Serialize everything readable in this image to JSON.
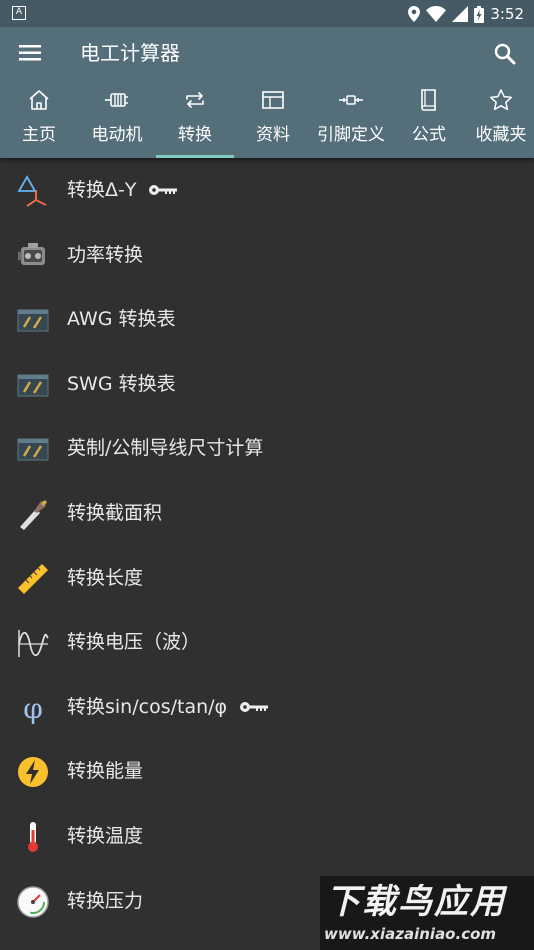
{
  "status_bar": {
    "notification_icon_letter": "A",
    "time": "3:52"
  },
  "app_bar": {
    "title": "电工计算器"
  },
  "tabs": [
    {
      "label": "主页",
      "icon": "home-icon"
    },
    {
      "label": "电动机",
      "icon": "motor-icon"
    },
    {
      "label": "转换",
      "icon": "convert-icon",
      "active": true
    },
    {
      "label": "资料",
      "icon": "table-icon"
    },
    {
      "label": "引脚定义",
      "icon": "connector-icon"
    },
    {
      "label": "公式",
      "icon": "book-icon"
    },
    {
      "label": "收藏夹",
      "icon": "star-icon"
    }
  ],
  "list": [
    {
      "label": "转换Δ-Y",
      "icon": "delta-star-icon",
      "locked": true
    },
    {
      "label": "功率转换",
      "icon": "engine-icon"
    },
    {
      "label": "AWG 转换表",
      "icon": "wire-table-icon"
    },
    {
      "label": "SWG 转换表",
      "icon": "wire-table-icon"
    },
    {
      "label": "英制/公制导线尺寸计算",
      "icon": "wire-table-icon"
    },
    {
      "label": "转换截面积",
      "icon": "cable-cross-section-icon"
    },
    {
      "label": "转换长度",
      "icon": "ruler-icon"
    },
    {
      "label": "转换电压（波）",
      "icon": "sine-wave-icon"
    },
    {
      "label": "转换sin/cos/tan/φ",
      "icon": "phi-icon",
      "locked": true
    },
    {
      "label": "转换能量",
      "icon": "lightning-icon"
    },
    {
      "label": "转换温度",
      "icon": "thermometer-icon"
    },
    {
      "label": "转换压力",
      "icon": "gauge-icon"
    }
  ],
  "watermark": {
    "main": "下载鸟应用",
    "sub": "www.xiazainiao.com"
  },
  "colors": {
    "status_bar": "#455a64",
    "app_bar": "#546e7a",
    "background": "#303030",
    "tab_indicator": "#80cbc4"
  }
}
